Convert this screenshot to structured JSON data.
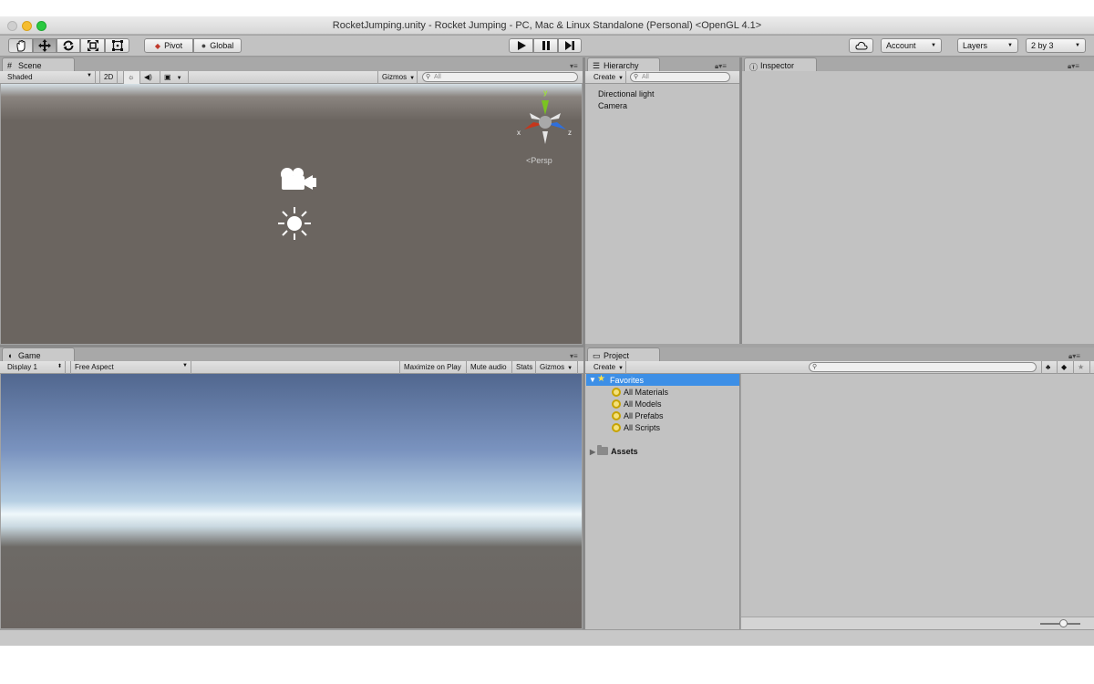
{
  "window": {
    "title": "RocketJumping.unity - Rocket Jumping - PC, Mac & Linux Standalone (Personal) <OpenGL 4.1>"
  },
  "toolbar": {
    "transform_tools": [
      "hand-tool",
      "move-tool",
      "rotate-tool",
      "scale-tool",
      "rect-tool"
    ],
    "pivot_label": "Pivot",
    "global_label": "Global",
    "account_label": "Account",
    "layers_label": "Layers",
    "layout_label": "2 by 3"
  },
  "scene": {
    "tab_label": "Scene",
    "shading_mode": "Shaded",
    "mode_2d": "2D",
    "gizmos_label": "Gizmos",
    "search_placeholder": "All",
    "axis_y": "y",
    "axis_x": "x",
    "axis_z": "z",
    "projection_label": "Persp"
  },
  "game": {
    "tab_label": "Game",
    "display_label": "Display 1",
    "aspect_label": "Free Aspect",
    "maximize_label": "Maximize on Play",
    "mute_label": "Mute audio",
    "stats_label": "Stats",
    "gizmos_label": "Gizmos"
  },
  "hierarchy": {
    "tab_label": "Hierarchy",
    "create_label": "Create",
    "search_placeholder": "All",
    "items": [
      "Directional light",
      "Camera"
    ]
  },
  "inspector": {
    "tab_label": "Inspector"
  },
  "project": {
    "tab_label": "Project",
    "create_label": "Create",
    "favorites_label": "Favorites",
    "favorites": [
      "All Materials",
      "All Models",
      "All Prefabs",
      "All Scripts"
    ],
    "assets_label": "Assets"
  },
  "colors": {
    "selection": "#3d8fe6",
    "panel": "#c2c2c2"
  }
}
